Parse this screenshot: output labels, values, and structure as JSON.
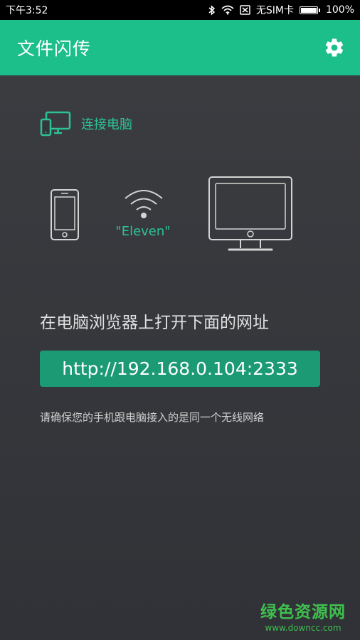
{
  "status_bar": {
    "time": "下午3:52",
    "carrier": "无SIM卡",
    "battery_percent": "100%",
    "battery_level": 1.0,
    "icons": [
      "bluetooth-icon",
      "wifi-signal-icon",
      "no-sim-icon",
      "battery-icon"
    ]
  },
  "app_bar": {
    "title": "文件闪传",
    "settings_icon": "gear-icon"
  },
  "connect": {
    "label": "连接电脑",
    "icon": "devices-icon"
  },
  "network": {
    "ssid": "\"Eleven\""
  },
  "instruction": "在电脑浏览器上打开下面的网址",
  "url": "http://192.168.0.104:2333",
  "note": "请确保您的手机跟电脑接入的是同一个无线网络",
  "watermark": {
    "title": "绿色资源网",
    "url": "www.downcc.com"
  },
  "colors": {
    "accent": "#1cbf8a",
    "url_button": "#1b9a73",
    "text_accent": "#2cc295",
    "background": "#34363c"
  }
}
